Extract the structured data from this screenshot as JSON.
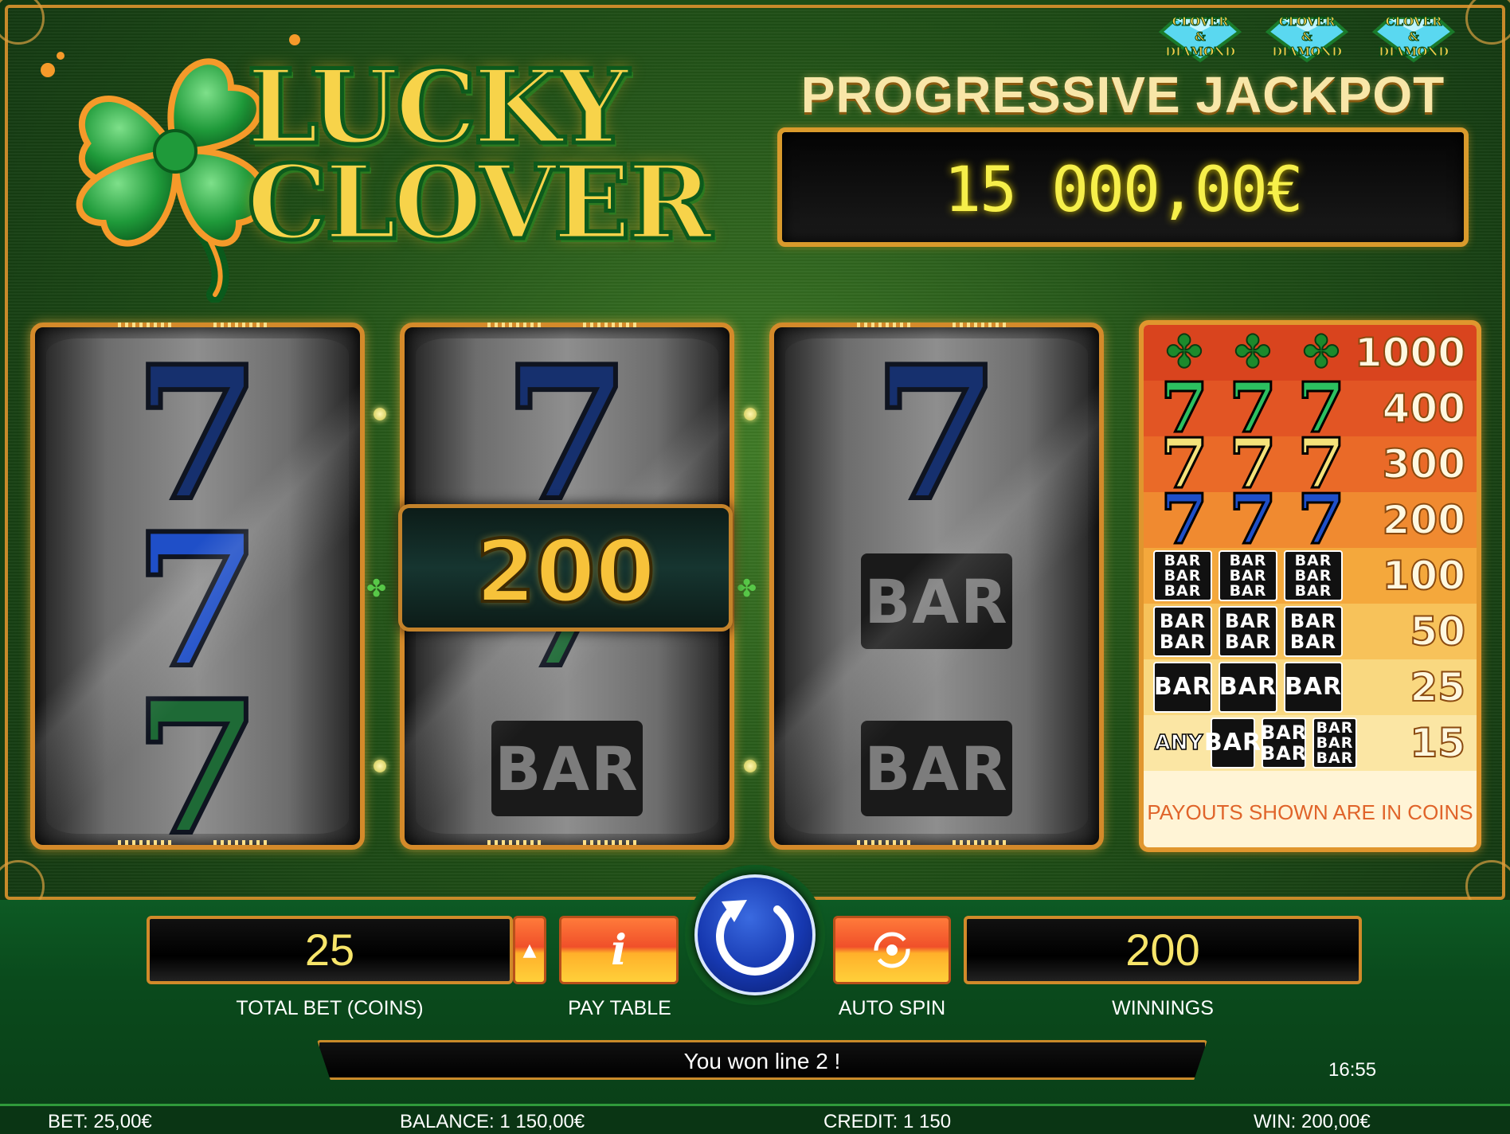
{
  "game": {
    "logo_lines": [
      "LUCKY",
      "CLOVER"
    ],
    "badge_text": [
      "CLOVER",
      "&",
      "DIAMOND"
    ]
  },
  "jackpot": {
    "title": "PROGRESSIVE JACKPOT",
    "value": "15 000,00€"
  },
  "reels": [
    {
      "symbols": [
        "seven-blue-dark",
        "seven-blue",
        "seven-green"
      ]
    },
    {
      "symbols": [
        "seven-blue-dark",
        "seven-green",
        "bar"
      ]
    },
    {
      "symbols": [
        "seven-blue-dark",
        "bar",
        "bar"
      ]
    }
  ],
  "win_banner": {
    "value": "200"
  },
  "bar_text": "BAR",
  "paytable": {
    "rows": [
      {
        "symbol": "clover",
        "payout": "1000"
      },
      {
        "symbol": "seven-green",
        "payout": "400"
      },
      {
        "symbol": "seven-yellow",
        "payout": "300"
      },
      {
        "symbol": "seven-blue",
        "payout": "200"
      },
      {
        "symbol": "triple-bar",
        "payout": "100"
      },
      {
        "symbol": "double-bar",
        "payout": "50"
      },
      {
        "symbol": "single-bar",
        "payout": "25"
      },
      {
        "symbol": "any-bar",
        "payout": "15",
        "any_label": "ANY"
      }
    ],
    "footer": "PAYOUTS SHOWN ARE IN COINS",
    "row_colors": [
      "#d9441e",
      "#e25524",
      "#ea6a28",
      "#f08a30",
      "#f4a83c",
      "#f7c25a",
      "#f9d880",
      "#fbe6a4"
    ]
  },
  "controls": {
    "total_bet_value": "25",
    "total_bet_label": "TOTAL BET (COINS)",
    "pay_table_label": "PAY TABLE",
    "auto_spin_label": "AUTO SPIN",
    "winnings_value": "200",
    "winnings_label": "WINNINGS",
    "status_message": "You won line 2 !",
    "clock": "16:55"
  },
  "bottom_bar": {
    "bet": "BET: 25,00€",
    "balance": "BALANCE: 1 150,00€",
    "credit": "CREDIT: 1 150",
    "win": "WIN: 200,00€"
  },
  "colors": {
    "accent_gold": "#d48a2a",
    "jackpot_digits": "#f6ef4a",
    "seven_blue": "#1f4fc8",
    "seven_blue_dark": "#16306e",
    "seven_green": "#1e6a36",
    "seven_yellow": "#f4e27a",
    "felt_green": "#1f4e16"
  }
}
